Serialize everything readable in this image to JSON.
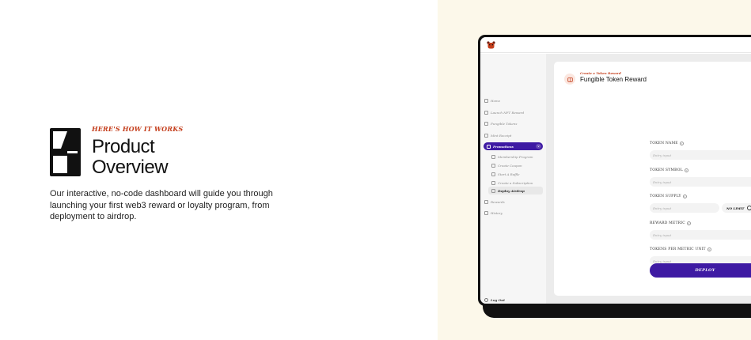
{
  "hero": {
    "eyebrow": "HERE'S HOW IT WORKS",
    "title": "Product Overview",
    "description": "Our interactive, no-code dashboard will guide you through launching your first web3 reward or loyalty program, from deployment to airdrop.",
    "step_icon": "number-one-icon"
  },
  "colors": {
    "accent_orange": "#c43e1c",
    "accent_purple": "#3e1aa3",
    "cream_panel": "#fcf8ea"
  },
  "app": {
    "brand_icon": "bear-logo-icon",
    "sidebar": {
      "items": [
        {
          "label": "Home",
          "icon": "home-icon"
        },
        {
          "label": "Launch NFT Reward",
          "icon": "box-icon"
        },
        {
          "label": "Fungible Tokens",
          "icon": "token-icon"
        },
        {
          "label": "Mint Receipt",
          "icon": "receipt-icon"
        },
        {
          "label": "Promotions",
          "icon": "tag-icon"
        }
      ],
      "sub_items": [
        {
          "label": "Membership Program",
          "icon": "card-icon"
        },
        {
          "label": "Create Coupon",
          "icon": "coupon-icon"
        },
        {
          "label": "Start A Raffle",
          "icon": "ticket-icon"
        },
        {
          "label": "Create a Subscription",
          "icon": "repeat-icon"
        },
        {
          "label": "Deploy Airdrop",
          "icon": "airdrop-icon"
        }
      ],
      "lower_items": [
        {
          "label": "Rewards",
          "icon": "trophy-icon"
        },
        {
          "label": "History",
          "icon": "clock-icon"
        }
      ],
      "logout": "Log Out",
      "chevron": "v"
    },
    "card": {
      "eyebrow": "Create a Token Reward",
      "title": "Fungible Token Reward",
      "icon": "token-box-icon",
      "fields": {
        "token_name": {
          "label": "TOKEN NAME",
          "placeholder": "Entry input"
        },
        "token_symbol": {
          "label": "TOKEN SYMBOL",
          "placeholder": "Entry input"
        },
        "token_supply": {
          "label": "TOKEN SUPPLY",
          "placeholder": "Entry input",
          "toggle_label": "NO LIMIT"
        },
        "reward_metric": {
          "label": "REWARD METRIC",
          "placeholder": "Entry input"
        },
        "tokens_per_unit": {
          "label": "TOKENS PER METRIC UNIT",
          "placeholder": "Entry input"
        }
      },
      "help_glyph": "?",
      "deploy_label": "DEPLOY"
    }
  }
}
